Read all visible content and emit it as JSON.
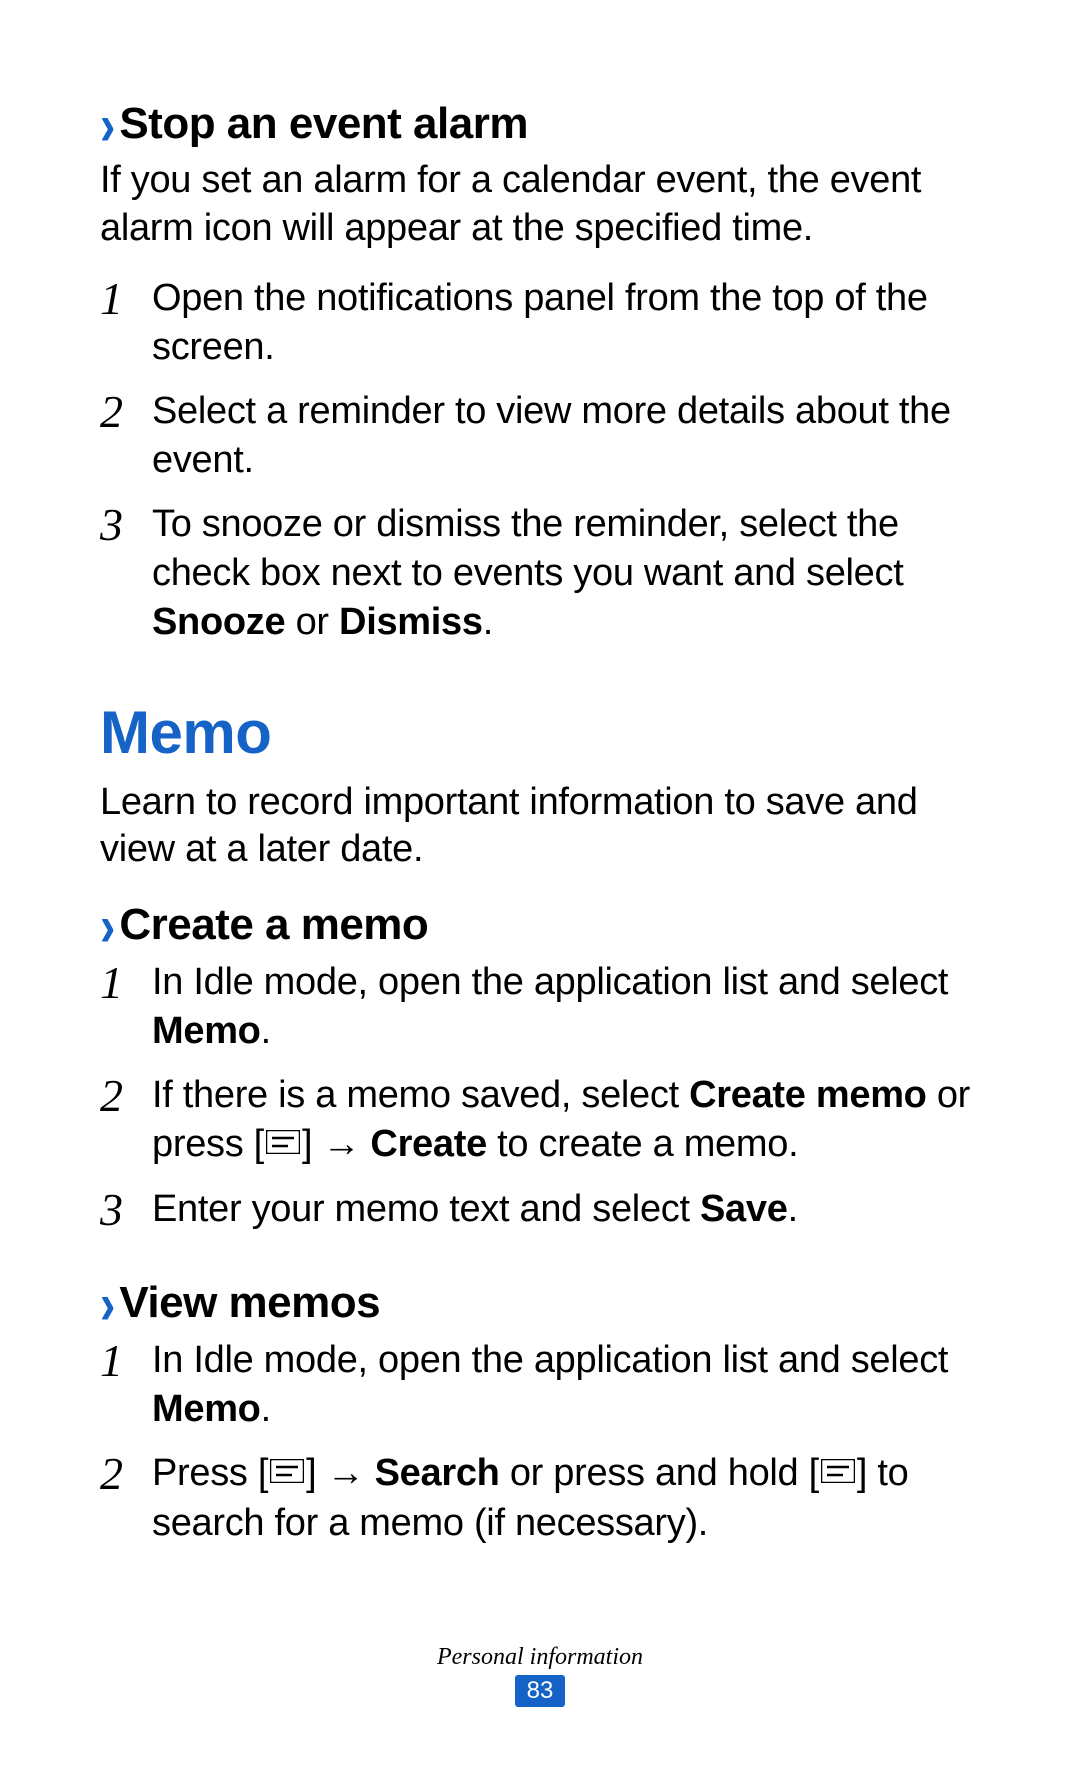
{
  "section1": {
    "heading": "Stop an event alarm",
    "intro": "If you set an alarm for a calendar event, the event alarm icon will appear at the specified time.",
    "steps": [
      {
        "n": "1",
        "pre": "Open the notifications panel from the top of the screen."
      },
      {
        "n": "2",
        "pre": "Select a reminder to view more details about the event."
      },
      {
        "n": "3",
        "pre": "To snooze or dismiss the reminder, select the check box next to events you want and select ",
        "b1": "Snooze",
        "mid": " or ",
        "b2": "Dismiss",
        "post": "."
      }
    ]
  },
  "memo": {
    "title": "Memo",
    "intro": "Learn to record important information to save and view at a later date."
  },
  "create": {
    "heading": "Create a memo",
    "steps": [
      {
        "n": "1",
        "pre": "In Idle mode, open the application list and select ",
        "b1": "Memo",
        "post": "."
      },
      {
        "n": "2",
        "pre": "If there is a memo saved, select ",
        "b1": "Create memo",
        "mid": " or press [",
        "icon": true,
        "mid2": "] → ",
        "b2": "Create",
        "post": " to create a memo."
      },
      {
        "n": "3",
        "pre": "Enter your memo text and select ",
        "b1": "Save",
        "post": "."
      }
    ]
  },
  "view": {
    "heading": "View memos",
    "steps": [
      {
        "n": "1",
        "pre": "In Idle mode, open the application list and select ",
        "b1": "Memo",
        "post": "."
      },
      {
        "n": "2",
        "pre": "Press [",
        "icon": true,
        "mid": "] → ",
        "b1": "Search",
        "mid2": " or press and hold [",
        "icon2": true,
        "post": "] to search for a memo (if necessary)."
      }
    ]
  },
  "footer": {
    "section": "Personal information",
    "page": "83"
  }
}
